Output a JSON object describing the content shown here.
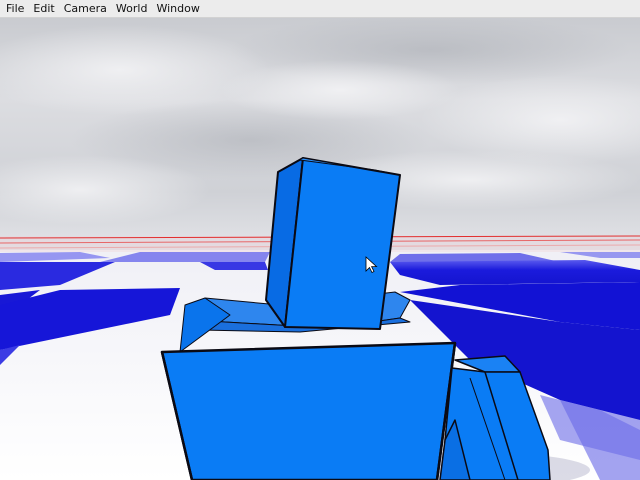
{
  "menu": {
    "items": [
      {
        "label": "File"
      },
      {
        "label": "Edit"
      },
      {
        "label": "Camera"
      },
      {
        "label": "World"
      },
      {
        "label": "Window"
      }
    ]
  },
  "scene": {
    "sky_color": "#d9dbe0",
    "ground_blue": "#1a1adb",
    "ground_white": "#f6f6fb",
    "horizon_line_color": "#e8303a",
    "figure_color": "#0a7cf5",
    "figure_edge_color": "#0a0a14",
    "cursor": "mouse-pointer-icon"
  }
}
